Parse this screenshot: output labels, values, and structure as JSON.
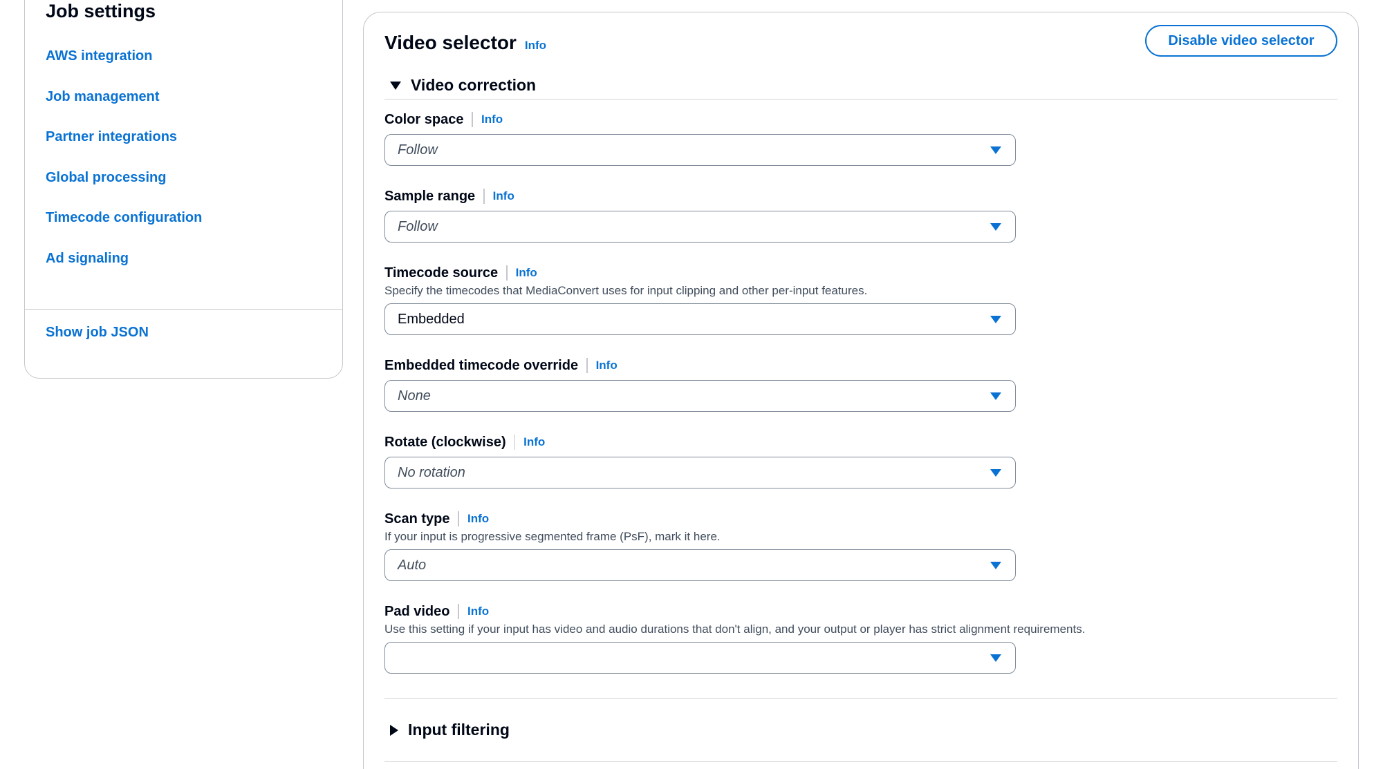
{
  "nav": {
    "title": "Job settings",
    "items": [
      "AWS integration",
      "Job management",
      "Partner integrations",
      "Global processing",
      "Timecode configuration",
      "Ad signaling"
    ],
    "show_json": "Show job JSON"
  },
  "main": {
    "title": "Video selector",
    "info": "Info",
    "disable_button": "Disable video selector"
  },
  "video_correction": {
    "heading": "Video correction",
    "fields": {
      "color_space": {
        "label": "Color space",
        "info": "Info",
        "value": "Follow"
      },
      "sample_range": {
        "label": "Sample range",
        "info": "Info",
        "value": "Follow"
      },
      "timecode_source": {
        "label": "Timecode source",
        "info": "Info",
        "description": "Specify the timecodes that MediaConvert uses for input clipping and other per-input features.",
        "value": "Embedded"
      },
      "embedded_timecode_override": {
        "label": "Embedded timecode override",
        "info": "Info",
        "value": "None"
      },
      "rotate": {
        "label": "Rotate (clockwise)",
        "info": "Info",
        "value": "No rotation"
      },
      "scan_type": {
        "label": "Scan type",
        "info": "Info",
        "description": "If your input is progressive segmented frame (PsF), mark it here.",
        "value": "Auto"
      },
      "pad_video": {
        "label": "Pad video",
        "info": "Info",
        "description": "Use this setting if your input has video and audio durations that don't align, and your output or player has strict alignment requirements.",
        "value": ""
      }
    }
  },
  "input_filtering": {
    "heading": "Input filtering"
  },
  "colors": {
    "link": "#0972d3",
    "text": "#000716",
    "border": "#c6c6cd"
  }
}
